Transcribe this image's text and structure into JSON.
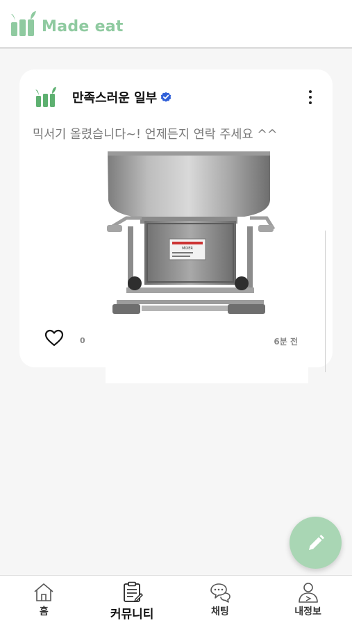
{
  "colors": {
    "brand": "#8fcaa0",
    "fab": "#a9d6b4",
    "verified": "#2f5fd8"
  },
  "header": {
    "brand_name": "Made eat",
    "logo_icon": "made-eat-logo"
  },
  "post": {
    "author": "만족스러운 일부",
    "verified_icon": "verified-badge-icon",
    "text": "믹서기 올렸습니다~! 언제든지 연락 주세요 ^^",
    "image": "stainless-mixer-photo",
    "image_label_text": "MIXER",
    "like_count": "0",
    "time": "6분 전"
  },
  "fab": {
    "icon": "pencil-icon"
  },
  "tabbar": {
    "items": [
      {
        "label": "홈",
        "icon": "home-icon"
      },
      {
        "label": "커뮤니티",
        "icon": "community-icon",
        "active": true
      },
      {
        "label": "채팅",
        "icon": "chat-icon"
      },
      {
        "label": "내정보",
        "icon": "profile-icon"
      }
    ]
  }
}
